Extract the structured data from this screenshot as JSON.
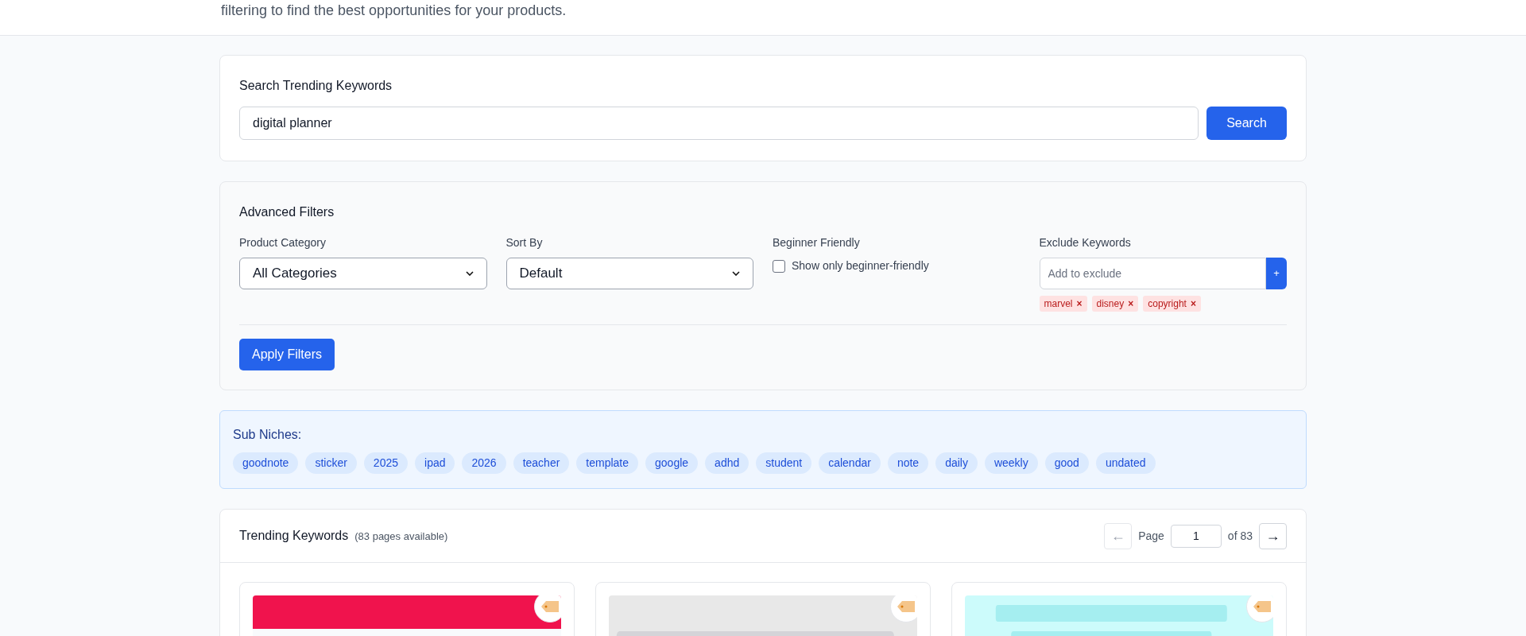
{
  "header": {
    "subtitle": "filtering to find the best opportunities for your products."
  },
  "search": {
    "title": "Search Trending Keywords",
    "value": "digital planner",
    "button": "Search"
  },
  "filters": {
    "title": "Advanced Filters",
    "fields": [
      {
        "kind": "select",
        "label": "Product Category",
        "value": "All Categories"
      },
      {
        "kind": "select",
        "label": "Sort By",
        "value": "Default"
      },
      {
        "kind": "checkbox",
        "label": "Beginner Friendly",
        "option": "Show only beginner-friendly",
        "checked": false
      },
      {
        "kind": "tags",
        "label": "Exclude Keywords",
        "placeholder": "Add to exclude",
        "add_button": "+",
        "tags": [
          {
            "label": "marvel",
            "remove": "×"
          },
          {
            "label": "disney",
            "remove": "×"
          },
          {
            "label": "copyright",
            "remove": "×"
          }
        ]
      }
    ],
    "apply_button": "Apply Filters"
  },
  "sub_niches": {
    "title": "Sub Niches:",
    "items": [
      "goodnote",
      "sticker",
      "2025",
      "ipad",
      "2026",
      "teacher",
      "template",
      "google",
      "adhd",
      "student",
      "calendar",
      "note",
      "daily",
      "weekly",
      "good",
      "undated"
    ]
  },
  "trending": {
    "title": "Trending Keywords",
    "note": "(83 pages available)",
    "pagination": {
      "prev": "←",
      "prev_disabled": true,
      "page_label": "Page",
      "page": "1",
      "of": "of 83",
      "next": "→"
    }
  }
}
